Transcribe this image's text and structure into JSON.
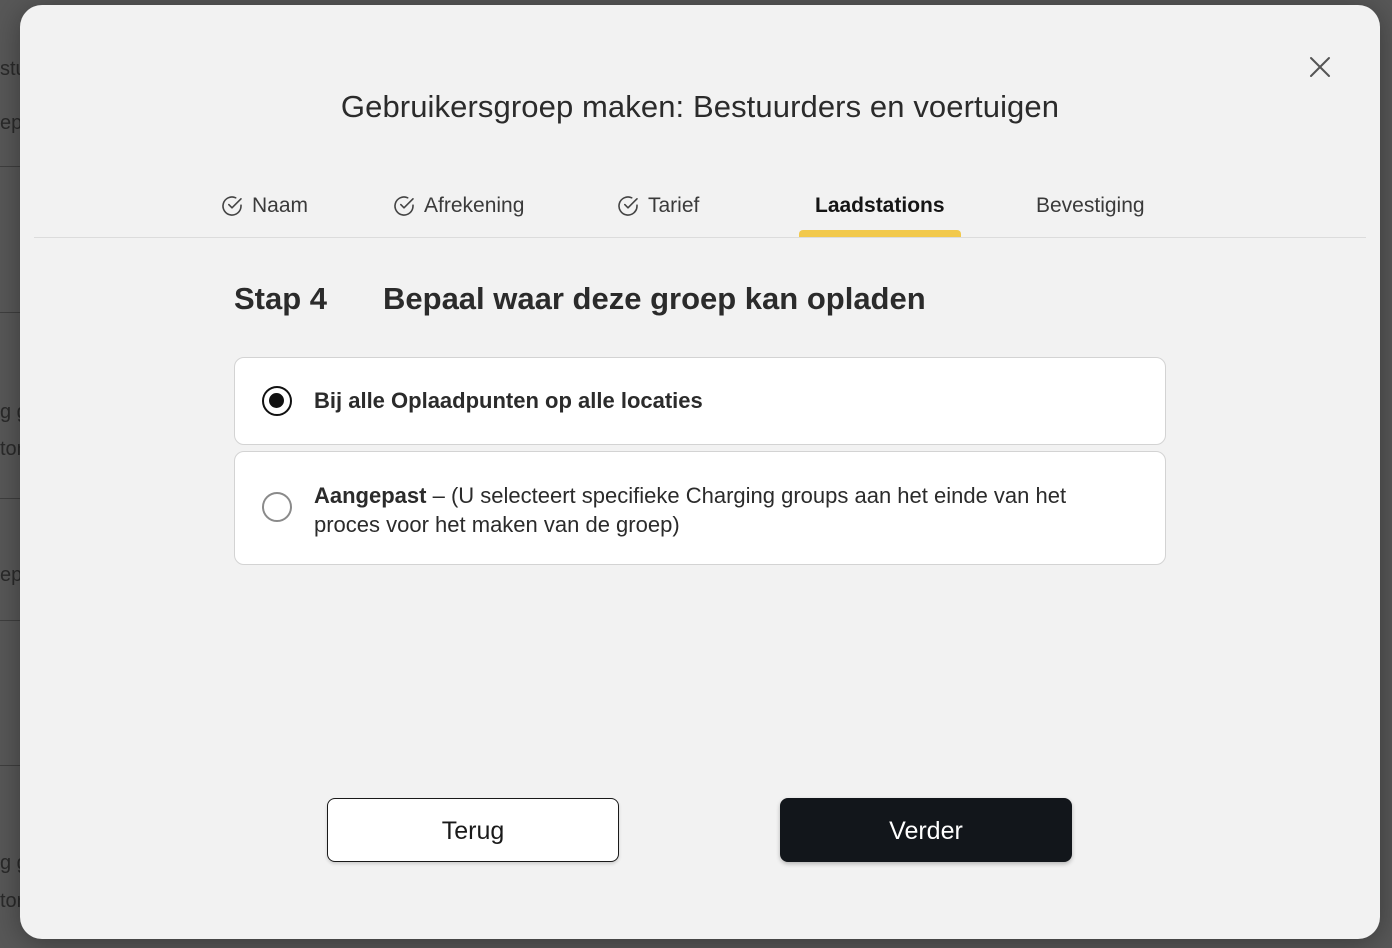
{
  "background": {
    "fragments": [
      "stu",
      "ep",
      "g g",
      "tor",
      "ep",
      "g g",
      "tor"
    ]
  },
  "modal": {
    "title": "Gebruikersgroep maken: Bestuurders en voertuigen",
    "close_icon": "close-icon"
  },
  "tabs": [
    {
      "label": "Naam",
      "completed": true,
      "active": false
    },
    {
      "label": "Afrekening",
      "completed": true,
      "active": false
    },
    {
      "label": "Tarief",
      "completed": true,
      "active": false
    },
    {
      "label": "Laadstations",
      "completed": false,
      "active": true
    },
    {
      "label": "Bevestiging",
      "completed": false,
      "active": false
    }
  ],
  "step": {
    "number_label": "Stap 4",
    "title": "Bepaal waar deze groep kan opladen"
  },
  "options": [
    {
      "label": "Bij alle Oplaadpunten op alle locaties",
      "selected": true
    },
    {
      "label_bold": "Aangepast",
      "label_rest": " – (U selecteert specifieke Charging groups aan het einde van het proces voor het maken van de groep)",
      "selected": false
    }
  ],
  "buttons": {
    "back_label": "Terug",
    "next_label": "Verder"
  },
  "colors": {
    "accent": "#f2c94c",
    "primary_button": "#12161b"
  }
}
